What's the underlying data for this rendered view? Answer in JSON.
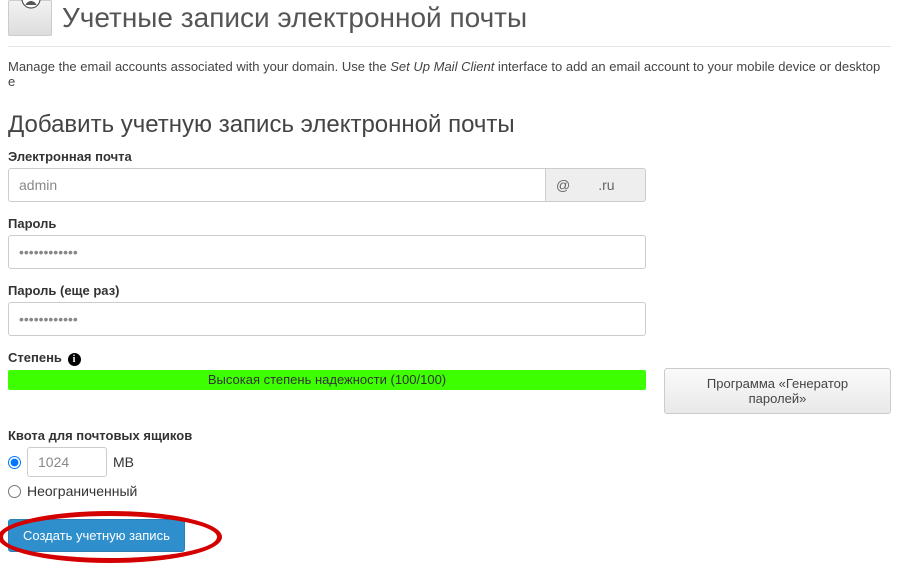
{
  "header": {
    "title": "Учетные записи электронной почты",
    "description_prefix": "Manage the email accounts associated with your domain. Use the ",
    "description_em": "Set Up Mail Client",
    "description_suffix": " interface to add an email account to your mobile device or desktop e"
  },
  "section": {
    "title": "Добавить учетную запись электронной почты"
  },
  "form": {
    "email_label": "Электронная почта",
    "email_value": "admin",
    "domain_at": "@",
    "domain_suffix": ".ru",
    "password_label": "Пароль",
    "password_value": "••••••••••••",
    "password2_label": "Пароль (еще раз)",
    "password2_value": "••••••••••••",
    "strength_label": "Степень",
    "strength_text": "Высокая степень надежности (100/100)",
    "generator_button": "Программа «Генератор паролей»",
    "quota_label": "Квота для почтовых ящиков",
    "quota_value": "1024",
    "quota_unit": "MB",
    "quota_unlimited_label": "Неограниченный",
    "submit_label": "Создать учетную запись"
  }
}
